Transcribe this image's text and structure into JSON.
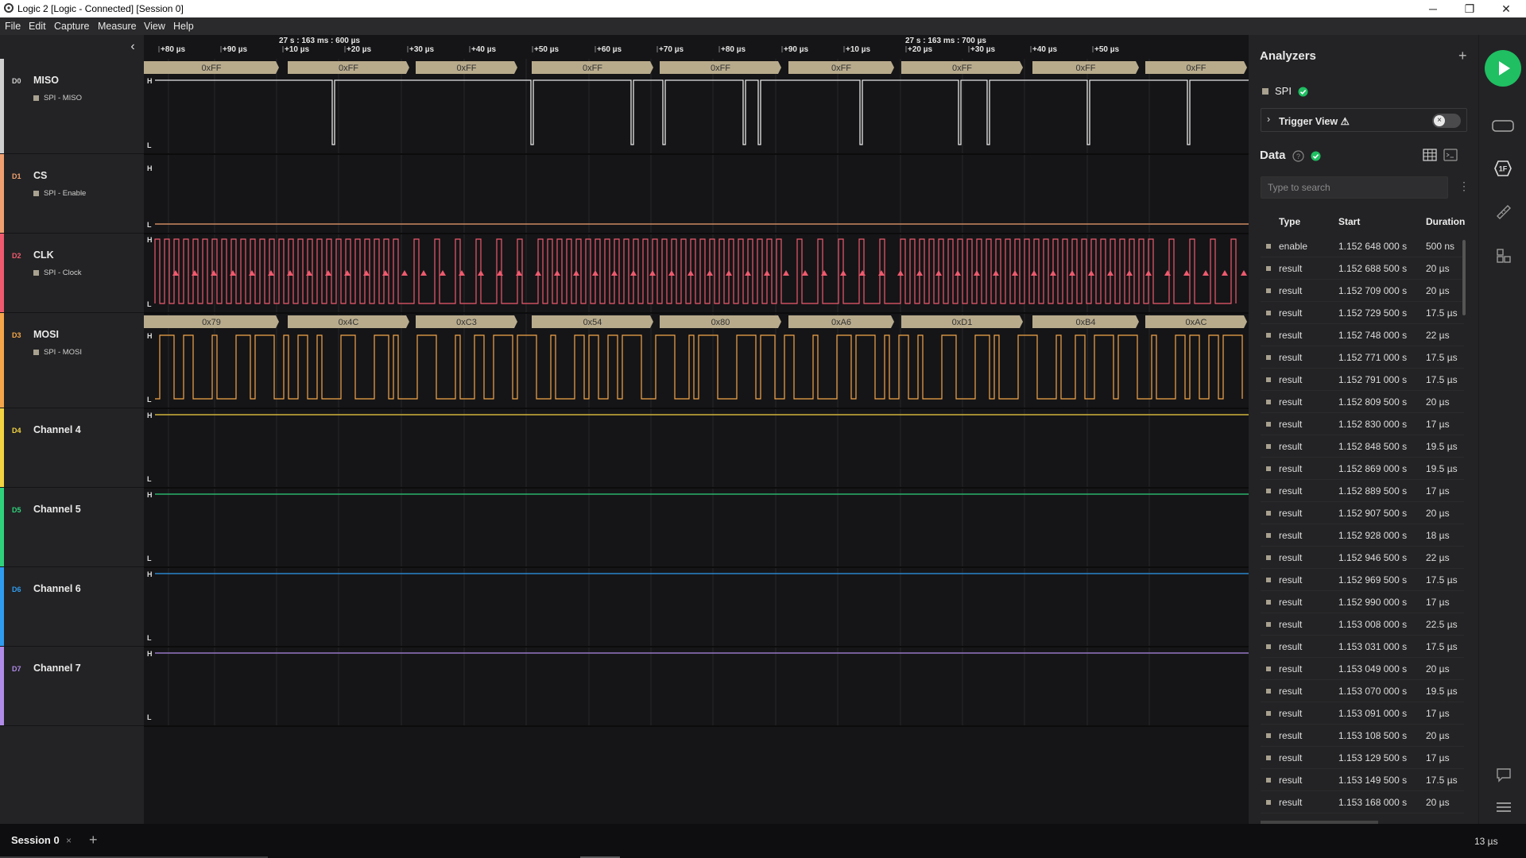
{
  "window": {
    "title": "Logic 2 [Logic - Connected] [Session 0]",
    "minimize": "─",
    "maximize": "❐",
    "close": "✕"
  },
  "menu": [
    "File",
    "Edit",
    "Capture",
    "Measure",
    "View",
    "Help"
  ],
  "timeline": {
    "ticks": [
      "+80 µs",
      "+90 µs",
      "+10 µs",
      "+20 µs",
      "+30 µs",
      "+40 µs",
      "+50 µs",
      "+60 µs",
      "+70 µs",
      "+80 µs",
      "+90 µs",
      "+10 µs",
      "+20 µs",
      "+30 µs",
      "+40 µs",
      "+50 µs"
    ],
    "markers": [
      "27 s : 163 ms : 600 µs",
      "27 s : 163 ms : 700 µs"
    ]
  },
  "channels": [
    {
      "id": "D0",
      "name": "MISO",
      "sub": "SPI - MISO",
      "color": "#ffffff"
    },
    {
      "id": "D1",
      "name": "CS",
      "sub": "SPI - Enable",
      "color": "#f0a070"
    },
    {
      "id": "D2",
      "name": "CLK",
      "sub": "SPI - Clock",
      "color": "#ef5a6e"
    },
    {
      "id": "D3",
      "name": "MOSI",
      "sub": "SPI - MOSI",
      "color": "#f5a64a"
    },
    {
      "id": "D4",
      "name": "Channel 4",
      "sub": "",
      "color": "#f3d341"
    },
    {
      "id": "D5",
      "name": "Channel 5",
      "sub": "",
      "color": "#2fd27b"
    },
    {
      "id": "D6",
      "name": "Channel 6",
      "sub": "",
      "color": "#2f9cf0"
    },
    {
      "id": "D7",
      "name": "Channel 7",
      "sub": "",
      "color": "#b08be8"
    }
  ],
  "level_labels": {
    "high": "H",
    "low": "L"
  },
  "miso_bytes": [
    "0xFF",
    "0xFF",
    "0xFF",
    "0xFF",
    "0xFF",
    "0xFF",
    "0xFF",
    "0xFF",
    "0xFF"
  ],
  "mosi_bytes": [
    "0x79",
    "0x4C",
    "0xC3",
    "0x54",
    "0x80",
    "0xA6",
    "0xD1",
    "0xB4",
    "0xAC"
  ],
  "analyzers": {
    "title": "Analyzers",
    "add": "+",
    "name": "SPI",
    "trigger_view": "Trigger View ⚠"
  },
  "data": {
    "title": "Data",
    "search_placeholder": "Type to search",
    "columns": [
      "Type",
      "Start",
      "Duration"
    ],
    "rows": [
      {
        "type": "enable",
        "start": "1.152 648 000 s",
        "duration": "500 ns"
      },
      {
        "type": "result",
        "start": "1.152 688 500 s",
        "duration": "20 µs"
      },
      {
        "type": "result",
        "start": "1.152 709 000 s",
        "duration": "20 µs"
      },
      {
        "type": "result",
        "start": "1.152 729 500 s",
        "duration": "17.5 µs"
      },
      {
        "type": "result",
        "start": "1.152 748 000 s",
        "duration": "22 µs"
      },
      {
        "type": "result",
        "start": "1.152 771 000 s",
        "duration": "17.5 µs"
      },
      {
        "type": "result",
        "start": "1.152 791 000 s",
        "duration": "17.5 µs"
      },
      {
        "type": "result",
        "start": "1.152 809 500 s",
        "duration": "20 µs"
      },
      {
        "type": "result",
        "start": "1.152 830 000 s",
        "duration": "17 µs"
      },
      {
        "type": "result",
        "start": "1.152 848 500 s",
        "duration": "19.5 µs"
      },
      {
        "type": "result",
        "start": "1.152 869 000 s",
        "duration": "19.5 µs"
      },
      {
        "type": "result",
        "start": "1.152 889 500 s",
        "duration": "17 µs"
      },
      {
        "type": "result",
        "start": "1.152 907 500 s",
        "duration": "20 µs"
      },
      {
        "type": "result",
        "start": "1.152 928 000 s",
        "duration": "18 µs"
      },
      {
        "type": "result",
        "start": "1.152 946 500 s",
        "duration": "22 µs"
      },
      {
        "type": "result",
        "start": "1.152 969 500 s",
        "duration": "17.5 µs"
      },
      {
        "type": "result",
        "start": "1.152 990 000 s",
        "duration": "17 µs"
      },
      {
        "type": "result",
        "start": "1.153 008 000 s",
        "duration": "22.5 µs"
      },
      {
        "type": "result",
        "start": "1.153 031 000 s",
        "duration": "17.5 µs"
      },
      {
        "type": "result",
        "start": "1.153 049 000 s",
        "duration": "20 µs"
      },
      {
        "type": "result",
        "start": "1.153 070 000 s",
        "duration": "19.5 µs"
      },
      {
        "type": "result",
        "start": "1.153 091 000 s",
        "duration": "17 µs"
      },
      {
        "type": "result",
        "start": "1.153 108 500 s",
        "duration": "20 µs"
      },
      {
        "type": "result",
        "start": "1.153 129 500 s",
        "duration": "17 µs"
      },
      {
        "type": "result",
        "start": "1.153 149 500 s",
        "duration": "17.5 µs"
      },
      {
        "type": "result",
        "start": "1.153 168 000 s",
        "duration": "20 µs"
      }
    ]
  },
  "status": {
    "session": "Session 0",
    "close": "×",
    "add": "+",
    "cursor": "13 µs"
  },
  "colors": {
    "accent": "#1fbf62",
    "bubble": "#b8ab8c"
  }
}
